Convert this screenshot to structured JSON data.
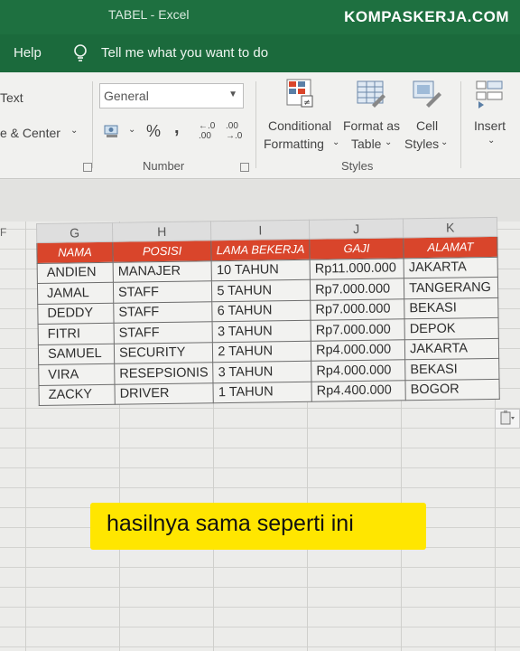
{
  "window": {
    "title": "TABEL - Excel",
    "watermark": "KOMPASKERJA.COM"
  },
  "menu": {
    "help": "Help",
    "tell_me": "Tell me what you want to do"
  },
  "ribbon": {
    "wrap_text": "Text",
    "merge_center": "e & Center",
    "number_format": "General",
    "percent": "%",
    "comma": ",",
    "inc_decimal": "←.0 .00",
    "dec_decimal": ".00 →.0",
    "number_group": "Number",
    "conditional_1": "Conditional",
    "conditional_2": "Formatting",
    "format_table_1": "Format as",
    "format_table_2": "Table",
    "cell_styles_1": "Cell",
    "cell_styles_2": "Styles",
    "styles_group": "Styles",
    "insert": "Insert"
  },
  "sheet": {
    "left_col_letter": "F",
    "columns": [
      "G",
      "H",
      "I",
      "J",
      "K"
    ],
    "headers": [
      "NAMA",
      "POSISI",
      "LAMA BEKERJA",
      "GAJI",
      "ALAMAT"
    ],
    "rows": [
      [
        "ANDIEN",
        "MANAJER",
        "10 TAHUN",
        "Rp11.000.000",
        "JAKARTA"
      ],
      [
        "JAMAL",
        "STAFF",
        "5 TAHUN",
        "Rp7.000.000",
        "TANGERANG"
      ],
      [
        "DEDDY",
        "STAFF",
        "6 TAHUN",
        "Rp7.000.000",
        "BEKASI"
      ],
      [
        "FITRI",
        "STAFF",
        "3 TAHUN",
        "Rp7.000.000",
        "DEPOK"
      ],
      [
        "SAMUEL",
        "SECURITY",
        "2 TAHUN",
        "Rp4.000.000",
        "JAKARTA"
      ],
      [
        "VIRA",
        "RESEPSIONIS",
        "3 TAHUN",
        "Rp4.000.000",
        "BEKASI"
      ],
      [
        "ZACKY",
        "DRIVER",
        "1 TAHUN",
        "Rp4.400.000",
        "BOGOR"
      ]
    ]
  },
  "caption": "hasilnya sama seperti ini",
  "colors": {
    "excel_green": "#1e7040",
    "header_fill": "#d9452b",
    "caption_bg": "#ffe600"
  }
}
